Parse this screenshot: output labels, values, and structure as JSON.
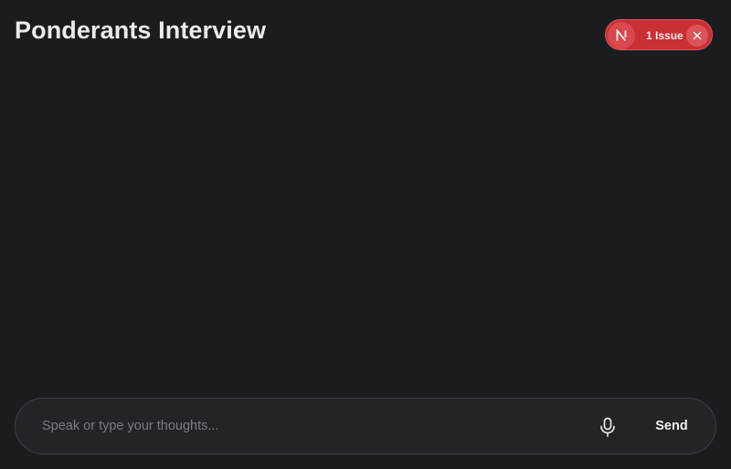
{
  "header": {
    "title": "Ponderants Interview"
  },
  "issue_indicator": {
    "badge_letter": "N",
    "label": "1 Issue",
    "badge_icon": "nextjs-n-icon",
    "close_icon": "close-icon",
    "color": "#c92f35"
  },
  "composer": {
    "placeholder": "Speak or type your thoughts...",
    "value": "",
    "mic_icon": "microphone-icon",
    "send_label": "Send"
  }
}
